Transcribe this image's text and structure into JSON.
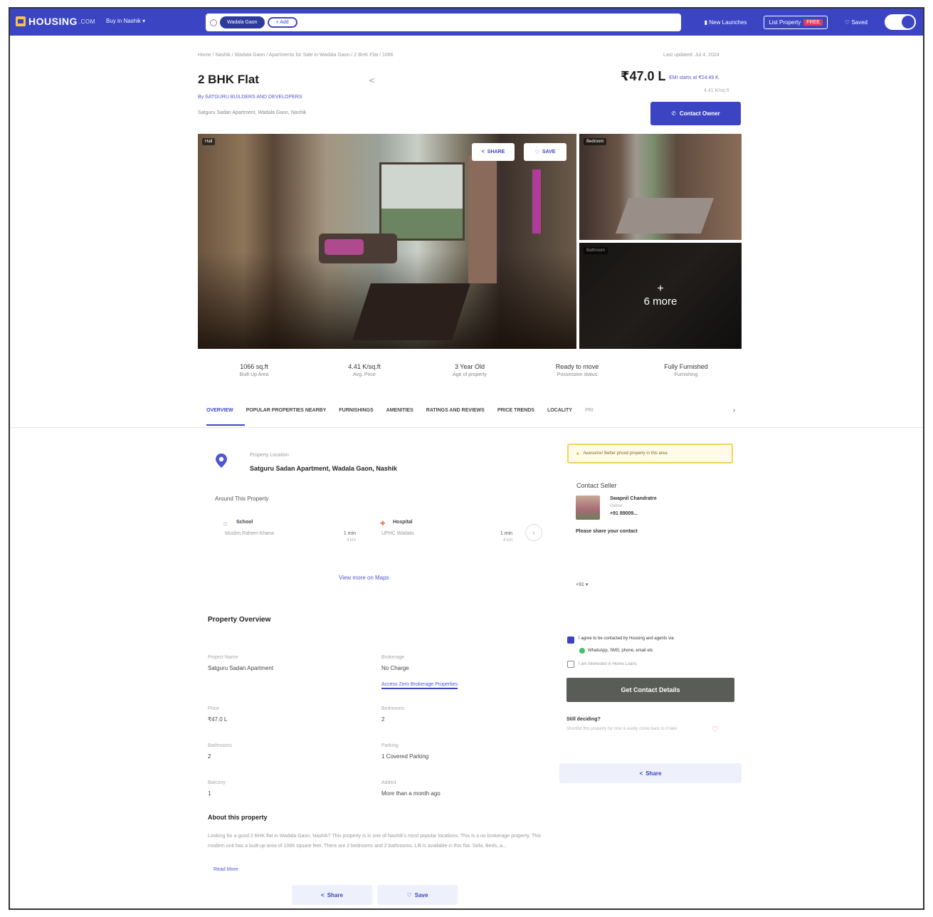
{
  "nav": {
    "logo": "HOUSING",
    "logo_suffix": ".COM",
    "city": "Buy in Nashik",
    "search_chips": [
      "Wadala Gaon",
      "+ Add"
    ],
    "post_ad": "New Launches",
    "list_property": "List Property",
    "free_badge": "FREE",
    "saved": "Saved"
  },
  "header": {
    "breadcrumb": "Home / Nashik / Wadala Gaon / Apartments for Sale in Wadala Gaon / 2 BHK Flat / 1066",
    "last_updated": "Last updated: Jul 4, 2024",
    "title": "2 BHK Flat",
    "builder": "By SATGURU BUILDERS AND DEVELOPERS",
    "address": "Satguru Sadan Apartment, Wadala Gaon, Nashik",
    "price": "₹47.0 L",
    "emi": "EMI starts at ₹24.49 K",
    "price_note": "4.41 K/sq.ft",
    "contact_owner": "Contact Owner"
  },
  "gallery": {
    "main_tag": "Hall",
    "side1_tag": "Bedroom",
    "side2_tag": "Bathroom",
    "share_label": "SHARE",
    "save_label": "SAVE",
    "more_plus": "+",
    "more_label": "6 more"
  },
  "highlights": [
    {
      "value": "1066 sq.ft",
      "label": "Built Up Area"
    },
    {
      "value": "4.41 K/sq.ft",
      "label": "Avg. Price"
    },
    {
      "value": "3 Year Old",
      "label": "Age of property"
    },
    {
      "value": "Ready to move",
      "label": "Possession status"
    },
    {
      "value": "Fully Furnished",
      "label": "Furnishing"
    }
  ],
  "tabs": [
    "OVERVIEW",
    "POPULAR PROPERTIES NEARBY",
    "FURNISHINGS",
    "AMENITIES",
    "RATINGS AND REVIEWS",
    "PRICE TRENDS",
    "LOCALITY",
    "PRI"
  ],
  "location": {
    "label": "Property Location",
    "value": "Satguru Sadan Apartment, Wadala Gaon, Nashik",
    "around_title": "Around This Property",
    "cards": [
      {
        "type": "School",
        "name": "Muslim Rahem Khana",
        "dist": "1 min",
        "time": "4 km"
      },
      {
        "type": "Hospital",
        "name": "UPHC Wadala",
        "dist": "1 min",
        "time": "4 km"
      }
    ],
    "view_maps": "View more on Maps"
  },
  "overview": {
    "title": "Property Overview",
    "items": [
      {
        "label": "Project Name",
        "value": "Satguru Sadan Apartment"
      },
      {
        "label": "Brokerage",
        "value": "No Charge"
      },
      {
        "label": "Price",
        "value": "₹47.0 L"
      },
      {
        "label": "Bedrooms",
        "value": "2"
      },
      {
        "label": "Bathrooms",
        "value": "2"
      },
      {
        "label": "Parking",
        "value": "1 Covered Parking"
      },
      {
        "label": "Balcony",
        "value": "1"
      },
      {
        "label": "Added",
        "value": "More than a month ago"
      }
    ],
    "zero_brokerage": "Access Zero Brokerage Properties"
  },
  "about": {
    "title": "About this property",
    "text": "Looking for a good 2 BHK flat in Wadala Gaon, Nashik? This property is in one of Nashik's most popular locations. This is a no brokerage property. This modern unit has a built-up area of 1066 square feet. There are 2 bedrooms and 2 bathrooms. Lift is available in this flat. Sofa, Beds, a...",
    "read_more": "Read More",
    "share": "Share",
    "save": "Save"
  },
  "seller": {
    "promo": "Awesome! Better priced property in this area",
    "title": "Contact Seller",
    "name": "Swapnil Chandratre",
    "role": "Owner",
    "phone": "+91 89009...",
    "share_prompt": "Please share your contact",
    "country_code": "+91 ▾",
    "agree": "I agree to be contacted by Housing and agents via",
    "channels": "WhatsApp, SMS, phone, email etc",
    "home_loan": "I am interested in Home Loans",
    "cta": "Get Contact Details",
    "still_deciding": "Still deciding?",
    "still_sub": "Shortlist this property for now & easily come back to it later",
    "share": "Share"
  },
  "colors": {
    "brand": "#3b45c4",
    "promo_border": "#f1d35a",
    "cta_bg": "#5a5c58"
  }
}
